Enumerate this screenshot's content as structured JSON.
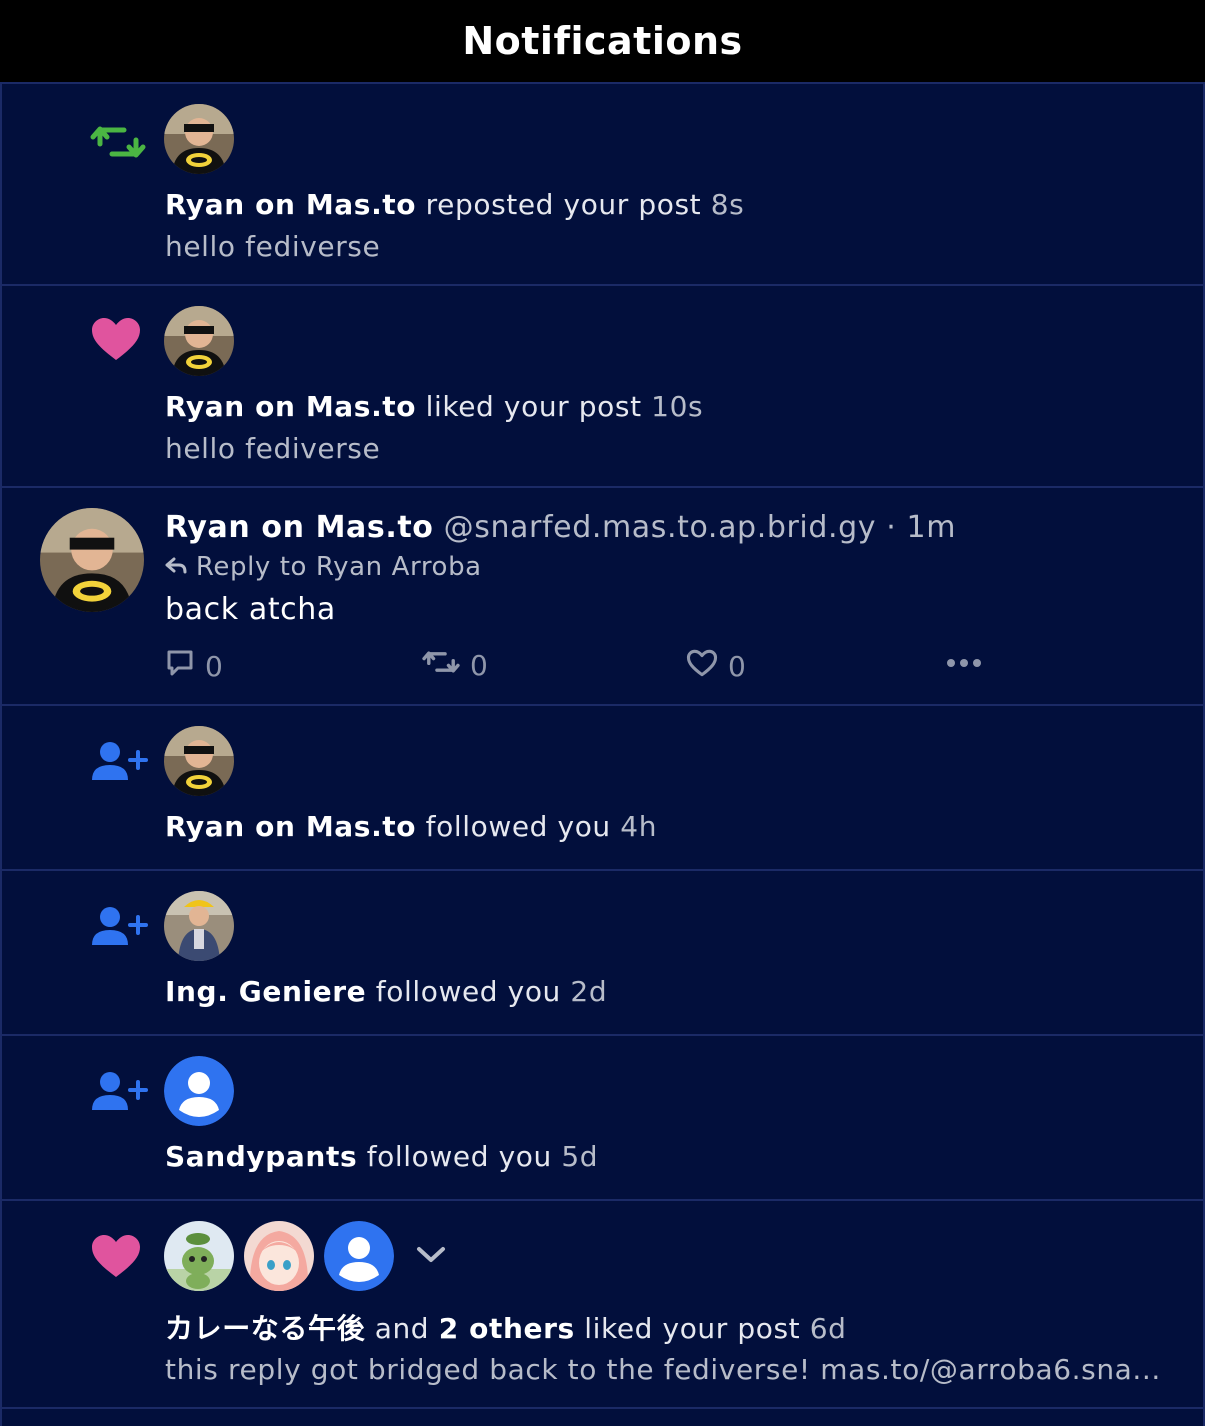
{
  "header": {
    "title": "Notifications"
  },
  "notifications": [
    {
      "type": "repost",
      "actor": "Ryan on Mas.to",
      "action": " reposted your post ",
      "time": "8s",
      "snippet": "hello fediverse"
    },
    {
      "type": "like",
      "actor": "Ryan on Mas.to",
      "action": " liked your post ",
      "time": "10s",
      "snippet": "hello fediverse"
    },
    {
      "type": "post",
      "author": "Ryan on Mas.to",
      "handle": "@snarfed.mas.to.ap.brid.gy",
      "sep": " · ",
      "time": "1m",
      "reply_to": "Reply to Ryan Arroba",
      "content": "back atcha",
      "counts": {
        "replies": "0",
        "reposts": "0",
        "likes": "0"
      }
    },
    {
      "type": "follow",
      "actor": "Ryan on Mas.to",
      "action": " followed you ",
      "time": "4h"
    },
    {
      "type": "follow",
      "actor": "Ing. Geniere",
      "action": " followed you ",
      "time": "2d"
    },
    {
      "type": "follow",
      "actor": "Sandypants",
      "action": " followed you ",
      "time": "5d"
    },
    {
      "type": "like",
      "actor": "カレーなる午後",
      "and": " and ",
      "others": "2 others",
      "action": " liked your post ",
      "time": "6d",
      "snippet": "this reply got bridged back to the fediverse! mas.to/@arroba6.sna..."
    }
  ],
  "colors": {
    "repost": "#4bb543",
    "like": "#e0549e",
    "follow": "#2f73f0",
    "background": "#020f3c"
  }
}
